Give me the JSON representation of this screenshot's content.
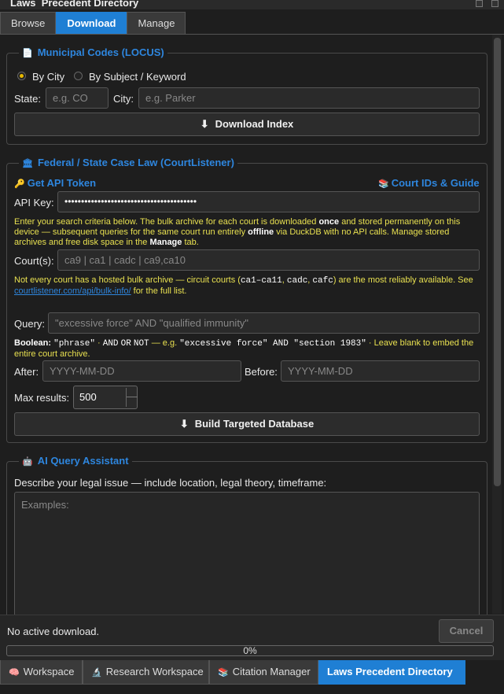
{
  "window": {
    "title": "Laws  Precedent Directory"
  },
  "tabs": [
    {
      "label": "Browse"
    },
    {
      "label": "Download"
    },
    {
      "label": "Manage"
    }
  ],
  "municipal": {
    "title": "Municipal Codes (LOCUS)",
    "icon": "document-icon",
    "radio_city": "By City",
    "radio_subject": "By Subject / Keyword",
    "state_label": "State:",
    "state_placeholder": "e.g. CO",
    "city_label": "City:",
    "city_placeholder": "e.g. Parker",
    "download_button": "Download Index",
    "download_icon": "⬇"
  },
  "caselaw": {
    "title": "Federal / State Case Law (CourtListener)",
    "icon": "courthouse-icon",
    "get_token": "Get API Token",
    "court_ids_guide": "Court IDs & Guide",
    "api_key_label": "API Key:",
    "api_key_value": "••••••••••••••••••••••••••••••••••••••••",
    "info": {
      "p1": "Enter your search criteria below. The bulk archive for each court is downloaded ",
      "b1": "once",
      "p2": " and stored permanently on this device — subsequent queries for the same court run entirely ",
      "b2": "offline",
      "p3": " via DuckDB with no API calls. Manage stored archives and free disk space in the ",
      "b3": "Manage",
      "p4": " tab."
    },
    "courts_label": "Court(s):",
    "courts_placeholder": "ca9  |  ca1  |  cadc  |  ca9,ca10",
    "bulk_note": {
      "p1": "Not every court has a hosted bulk archive — circuit courts (",
      "c1": "ca1–ca11",
      "p2": ", ",
      "c2": "cadc",
      "p3": ", ",
      "c3": "cafc",
      "p4": ") are the most reliably available. See ",
      "link": "courtlistener.com/api/bulk-info/",
      "p5": " for the full list."
    },
    "query_label": "Query:",
    "query_placeholder": "\"excessive force\" AND \"qualified immunity\"",
    "boolean_note": {
      "b1": "Boolean:",
      "c1": "\"phrase\"",
      "p1": " · ",
      "c2": "AND",
      "p2": " ",
      "c3": "OR",
      "p3": " ",
      "c4": "NOT",
      "p4": " — e.g. ",
      "c5": "\"excessive force\" AND \"section 1983\"",
      "p5": " · Leave blank to embed the entire court archive."
    },
    "after_label": "After:",
    "after_placeholder": "YYYY-MM-DD",
    "before_label": "Before:",
    "before_placeholder": "YYYY-MM-DD",
    "max_label": "Max results:",
    "max_value": "500",
    "build_button": "Build Targeted Database",
    "build_icon": "⬇"
  },
  "ai": {
    "title": "AI Query Assistant",
    "icon": "robot-icon",
    "prompt": "Describe your legal issue — include location, legal theory, timeframe:",
    "placeholder": "Examples:"
  },
  "status": {
    "text": "No active download.",
    "cancel": "Cancel",
    "progress": 0,
    "progress_label": "0%"
  },
  "bottom_tabs": [
    {
      "label": "Workspace",
      "icon": "brain-icon",
      "glyph": "🧠"
    },
    {
      "label": "Research Workspace",
      "icon": "microscope-icon",
      "glyph": "🔬"
    },
    {
      "label": "Citation Manager",
      "icon": "books-icon",
      "glyph": "📚"
    },
    {
      "label": "Laws Precedent Directory"
    }
  ],
  "colors": {
    "accent": "#1f7fd4",
    "link": "#2e86de",
    "note": "#e8e050"
  }
}
